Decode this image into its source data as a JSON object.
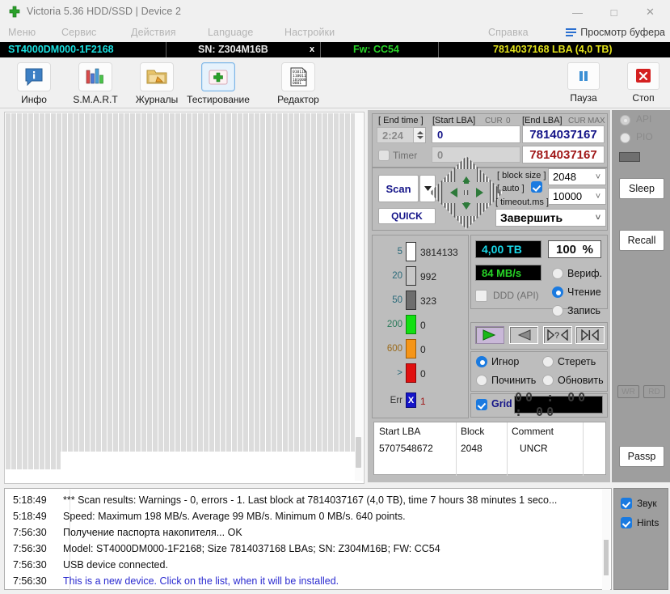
{
  "window": {
    "title": "Victoria 5.36 HDD/SSD | Device 2",
    "app_icon": "green-cross-icon",
    "minimize": "—",
    "maximize": "□",
    "close": "✕"
  },
  "menubar": {
    "items": [
      {
        "label": "Меню"
      },
      {
        "label": "Сервис"
      },
      {
        "label": "Действия"
      },
      {
        "label": "Language"
      },
      {
        "label": "Настройки"
      },
      {
        "label": "Справка"
      }
    ],
    "buffer_view": "Просмотр буфера"
  },
  "device_bar": {
    "model": "ST4000DM000-1F2168",
    "serial": "SN: Z304M16B",
    "close_mark": "x",
    "firmware": "Fw: CC54",
    "capacity": "7814037168 LBA (4,0 TB)"
  },
  "toolbar": {
    "items": [
      {
        "label": "Инфо",
        "icon": "info-icon"
      },
      {
        "label": "S.M.A.R.T",
        "icon": "smart-chart-icon"
      },
      {
        "label": "Журналы",
        "icon": "folder-edit-icon"
      },
      {
        "label": "Тестирование",
        "icon": "test-cross-icon"
      },
      {
        "label": "Редактор",
        "icon": "hex-editor-icon"
      }
    ],
    "pause": {
      "label": "Пауза",
      "icon": "pause-icon"
    },
    "stop": {
      "label": "Стоп",
      "icon": "stop-x-icon"
    }
  },
  "controls": {
    "end_time_label": "[ End time ]",
    "end_time_value": "2:24",
    "timer_label": "Timer",
    "timer_value": "0",
    "start_lba_label": "[Start LBA]",
    "start_lba_cur": "CUR",
    "start_lba_zero": "0",
    "start_lba_value": "0",
    "end_lba_label": "[End LBA]",
    "end_lba_cur": "CUR",
    "end_lba_max": "MAX",
    "end_lba_value": "7814037167",
    "end_lba_value2": "7814037167",
    "scan_button": "Scan",
    "quick_button": "QUICK",
    "block_size_label": "[ block size ]",
    "block_size_value": "2048",
    "auto_label": "[ auto ]",
    "timeout_label": "[ timeout.ms ]",
    "timeout_value": "10000",
    "action_value": "Завершить"
  },
  "block_stats": [
    {
      "threshold": "5",
      "count": "3814133",
      "color": "#ffffff"
    },
    {
      "threshold": "20",
      "count": "992",
      "color": "#c8c8c8"
    },
    {
      "threshold": "50",
      "count": "323",
      "color": "#6e6e6e"
    },
    {
      "threshold": "200",
      "count": "0",
      "color": "#12e012"
    },
    {
      "threshold": "600",
      "count": "0",
      "color": "#f59518"
    },
    {
      "threshold": ">",
      "count": "0",
      "color": "#e01010"
    },
    {
      "threshold": "Err",
      "count": "1",
      "color": "#1414c8"
    }
  ],
  "readout": {
    "capacity_lcd": "4,00 ТВ",
    "percent_value": "100",
    "percent_sign": "%",
    "speed_lcd": "84 MB/s",
    "ddd_label": "DDD (API)",
    "grid_label": "Grid",
    "elapsed_time": "00 : 00 : 00",
    "modes": [
      {
        "label": "Вериф.",
        "selected": false
      },
      {
        "label": "Чтение",
        "selected": true
      },
      {
        "label": "Запись",
        "selected": false
      }
    ],
    "actions": [
      {
        "label": "Игнор",
        "selected": true
      },
      {
        "label": "Стереть",
        "selected": false
      },
      {
        "label": "Починить",
        "selected": false
      },
      {
        "label": "Обновить",
        "selected": false
      }
    ],
    "transport": [
      {
        "name": "play-icon",
        "glyph": "▷",
        "selected": true
      },
      {
        "name": "rewind-icon",
        "glyph": "◁",
        "selected": false
      },
      {
        "name": "jump-query-icon",
        "glyph": "▷?◁",
        "selected": false
      },
      {
        "name": "skip-start-icon",
        "glyph": "▷|◁",
        "selected": false
      }
    ]
  },
  "defects_table": {
    "columns": [
      "Start LBA",
      "Block",
      "Comment"
    ],
    "rows": [
      {
        "start_lba": "5707548672",
        "block": "2048",
        "comment": "UNCR"
      }
    ]
  },
  "sidebar": {
    "api_label": "API",
    "pio_label": "PIO",
    "sleep_button": "Sleep",
    "recall_button": "Recall",
    "wr_button": "WR",
    "rd_button": "RD",
    "passp_button": "Passp"
  },
  "log": {
    "entries": [
      {
        "time": "5:18:49",
        "text": "*** Scan results: Warnings - 0, errors - 1. Last block at 7814037167 (4,0 TB), time 7 hours 38 minutes 1 seco...",
        "blue": false
      },
      {
        "time": "5:18:49",
        "text": "Speed: Maximum 198 MB/s. Average 99 MB/s. Minimum 0 MB/s. 640 points.",
        "blue": false
      },
      {
        "time": "7:56:30",
        "text": "Получение паспорта накопителя... OK",
        "blue": false
      },
      {
        "time": "7:56:30",
        "text": "Model: ST4000DM000-1F2168; Size 7814037168 LBAs; SN: Z304M16B; FW: CC54",
        "blue": false
      },
      {
        "time": "7:56:30",
        "text": "USB device connected.",
        "blue": false
      },
      {
        "time": "7:56:30",
        "text": "This is a new device. Click on the list, when it will be installed.",
        "blue": true
      }
    ]
  },
  "options": {
    "sound": {
      "label": "Звук",
      "checked": true
    },
    "hints": {
      "label": "Hints",
      "checked": true
    }
  },
  "colors": {
    "accent": "#1a7ae0",
    "lcd_cyan": "#19d8e8",
    "lcd_green": "#27d427",
    "panel": "#bdbdbd",
    "sidebar": "#9e9e9e"
  }
}
